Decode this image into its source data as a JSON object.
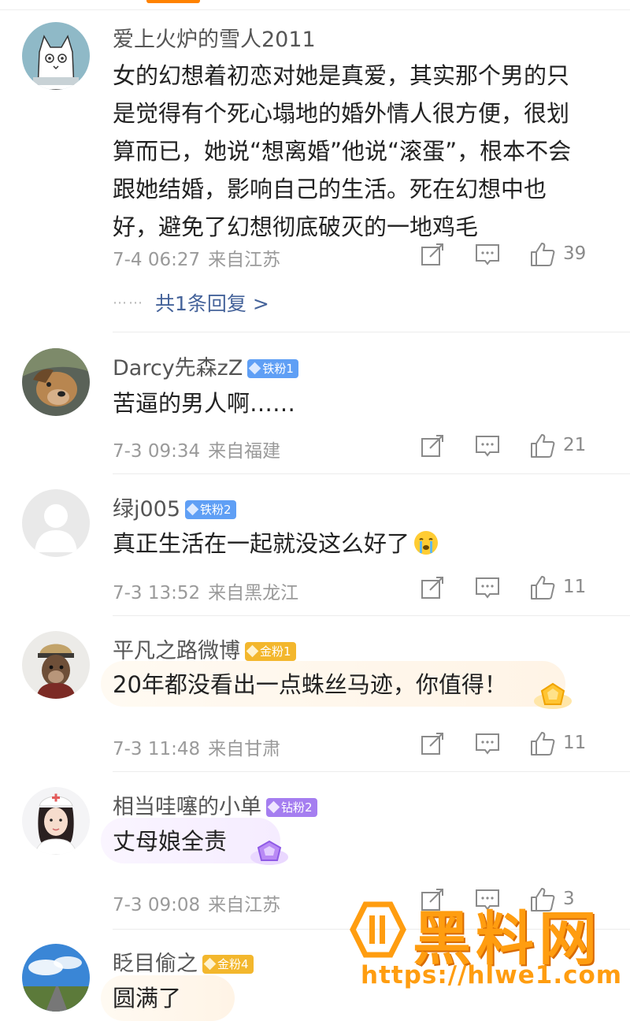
{
  "comments": [
    {
      "username": "爱上火炉的雪人2011",
      "text_lines": [
        "女的幻想着初恋对她是真爱，其实那个男的只",
        "是觉得有个死心塌地的婚外情人很方便，很划",
        "算而已，她说“想离婚”他说“滚蛋”，根本不会",
        "跟她结婚，影响自己的生活。死在幻想中也",
        "好，避免了幻想彻底破灭的一地鸡毛"
      ],
      "time": "7-4 06:27",
      "location": "来自江苏",
      "likes": "39",
      "reply_link": "共1条回复 >"
    },
    {
      "username": "Darcy先森zZ",
      "badge": "铁粉1",
      "text": "苦逼的男人啊……",
      "time": "7-3 09:34",
      "location": "来自福建",
      "likes": "21"
    },
    {
      "username": "绿j005",
      "badge": "铁粉2",
      "text": "真正生活在一起就没这么好了",
      "emoji": "crying-face-icon",
      "time": "7-3 13:52",
      "location": "来自黑龙江",
      "likes": "11"
    },
    {
      "username": "平凡之路微博",
      "badge": "金粉1",
      "text": "20年都没看出一点蛛丝马迹，你值得！",
      "time": "7-3 11:48",
      "location": "来自甘肃",
      "likes": "11"
    },
    {
      "username": "相当哇噻的小单",
      "badge": "钻粉2",
      "text": "丈母娘全责",
      "time": "7-3 09:08",
      "location": "来自江苏",
      "likes": "3"
    },
    {
      "username": "眨目偷之",
      "badge": "金粉4",
      "text": "圆满了"
    }
  ],
  "watermark": {
    "title": "黑料网",
    "url": "https://hlwe1.com"
  },
  "colors": {
    "accent": "#ff8200",
    "link": "#45639a",
    "meta": "#9a9a9a",
    "iron": "#5f9ff5",
    "gold": "#f3b72d",
    "diamond": "#a57ef0"
  }
}
